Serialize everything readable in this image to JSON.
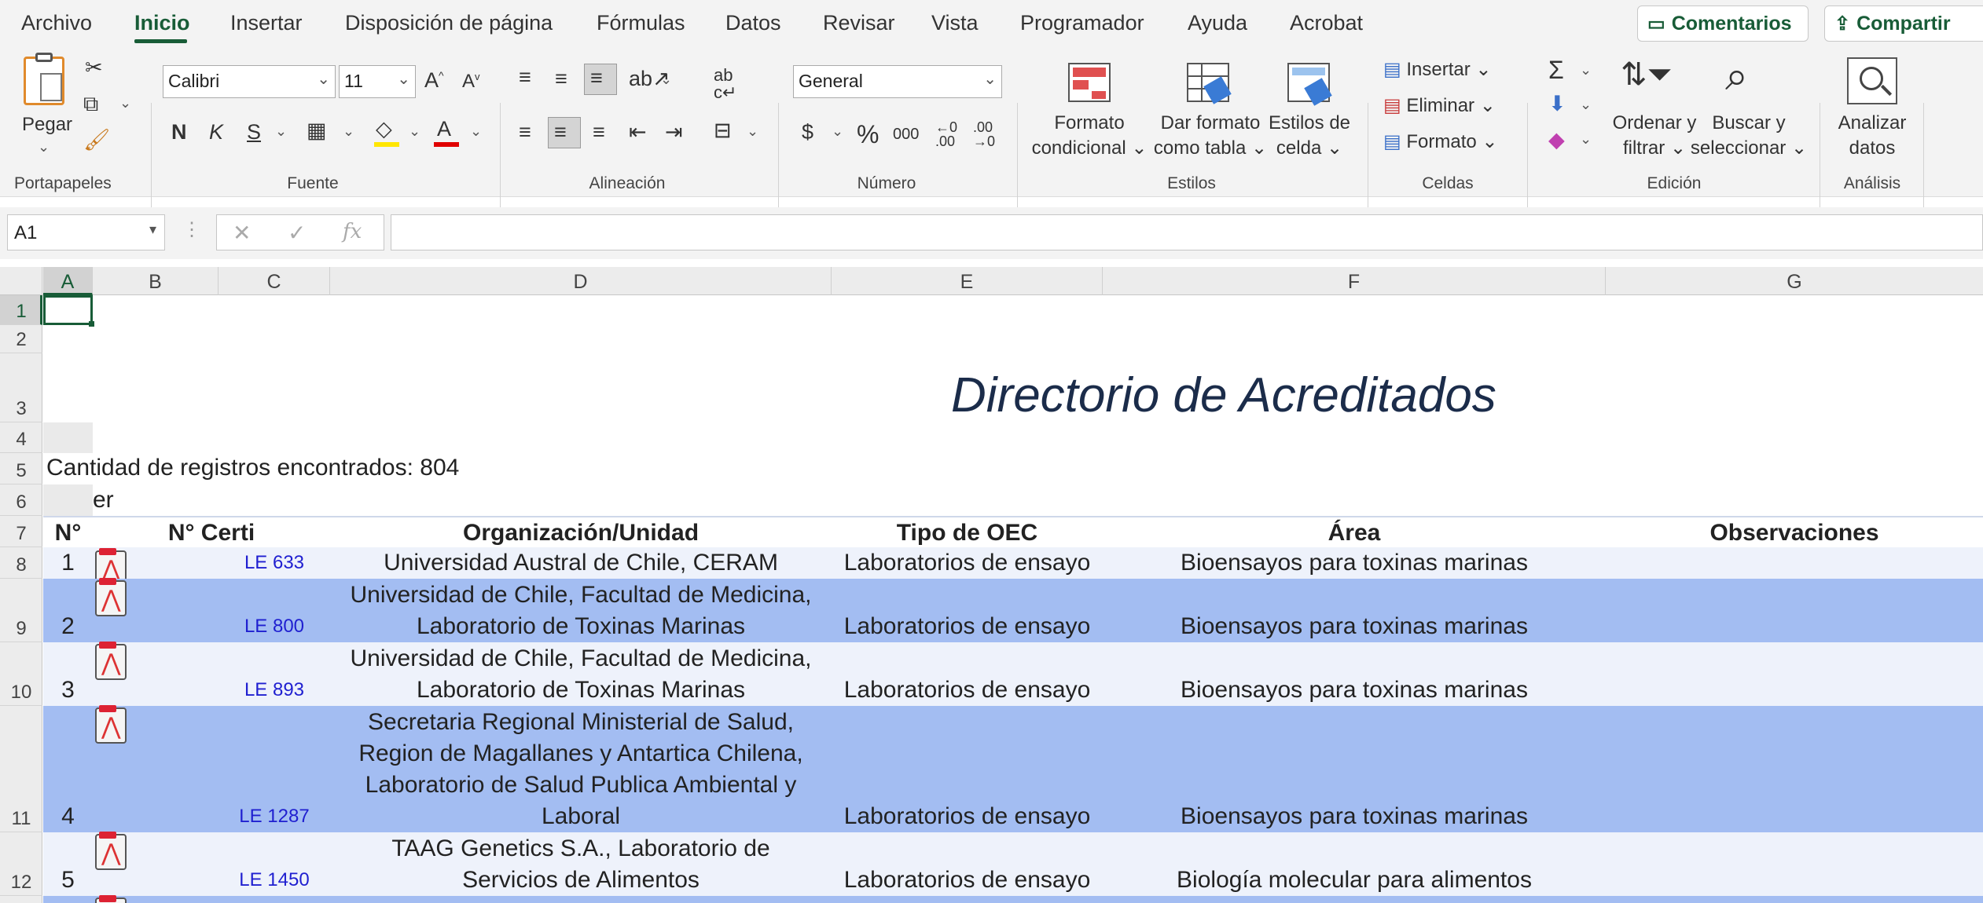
{
  "menu": {
    "tabs": [
      "Archivo",
      "Inicio",
      "Insertar",
      "Disposición de página",
      "Fórmulas",
      "Datos",
      "Revisar",
      "Vista",
      "Programador",
      "Ayuda",
      "Acrobat"
    ],
    "comments_label": "Comentarios",
    "share_label": "Compartir"
  },
  "ribbon": {
    "clipboard": {
      "paste_label": "Pegar",
      "group": "Portapapeles"
    },
    "font": {
      "name": "Calibri",
      "size": "11",
      "bold": "N",
      "italic": "K",
      "underline": "S",
      "group": "Fuente"
    },
    "alignment": {
      "group": "Alineación"
    },
    "number": {
      "format": "General",
      "currency": "$",
      "percent": "%",
      "thousands": "000",
      "group": "Número"
    },
    "styles": {
      "conditional": [
        "Formato",
        "condicional"
      ],
      "table": [
        "Dar formato",
        "como tabla"
      ],
      "cell": [
        "Estilos de",
        "celda"
      ],
      "group": "Estilos"
    },
    "cells": {
      "insert": "Insertar",
      "delete": "Eliminar",
      "format": "Formato",
      "group": "Celdas"
    },
    "editing": {
      "sort": [
        "Ordenar y",
        "filtrar"
      ],
      "find": [
        "Buscar y",
        "seleccionar"
      ],
      "group": "Edición"
    },
    "analysis": {
      "analyze": [
        "Analizar",
        "datos"
      ],
      "group": "Análisis"
    }
  },
  "formula_bar": {
    "name_box": "A1",
    "cancel": "✕",
    "enter": "✓",
    "fx": "fx",
    "value": ""
  },
  "columns": [
    "A",
    "B",
    "C",
    "D",
    "E",
    "F",
    "G"
  ],
  "rows": [
    "1",
    "2",
    "3",
    "4",
    "5",
    "6",
    "7",
    "8",
    "9",
    "10",
    "11",
    "12"
  ],
  "sheet": {
    "title": "Directorio de Acreditados",
    "count_text": "Cantidad de registros encontrados: 804",
    "row6_text": "er",
    "headers": {
      "n": "N°",
      "cert": "N° Certi",
      "org": "Organización/Unidad",
      "tipo": "Tipo de OEC",
      "area": "Área",
      "obs": "Observaciones"
    },
    "records": [
      {
        "n": "1",
        "cert": "LE 633",
        "org": [
          "Universidad Austral de Chile, CERAM"
        ],
        "tipo": "Laboratorios de ensayo",
        "area": "Bioensayos para toxinas marinas"
      },
      {
        "n": "2",
        "cert": "LE 800",
        "org": [
          "Universidad de Chile, Facultad de Medicina,",
          "Laboratorio de Toxinas Marinas"
        ],
        "tipo": "Laboratorios de ensayo",
        "area": "Bioensayos para toxinas marinas"
      },
      {
        "n": "3",
        "cert": "LE 893",
        "org": [
          "Universidad de Chile, Facultad de Medicina,",
          "Laboratorio de Toxinas Marinas"
        ],
        "tipo": "Laboratorios de ensayo",
        "area": "Bioensayos para toxinas marinas"
      },
      {
        "n": "4",
        "cert": "LE 1287",
        "org": [
          "Secretaria Regional Ministerial de Salud,",
          "Region de Magallanes y Antartica Chilena,",
          "Laboratorio de Salud Publica Ambiental y",
          "Laboral"
        ],
        "tipo": "Laboratorios de ensayo",
        "area": "Bioensayos para toxinas marinas"
      },
      {
        "n": "5",
        "cert": "LE 1450",
        "org": [
          "TAAG Genetics S.A., Laboratorio de",
          "Servicios de Alimentos"
        ],
        "tipo": "Laboratorios de ensayo",
        "area": "Biología molecular para alimentos"
      }
    ]
  },
  "colors": {
    "accent": "#185c37",
    "band_light": "#eef2fb",
    "band_dark": "#a3bdf2",
    "title": "#1b2c4a",
    "cert_link": "#1f1fd0"
  }
}
